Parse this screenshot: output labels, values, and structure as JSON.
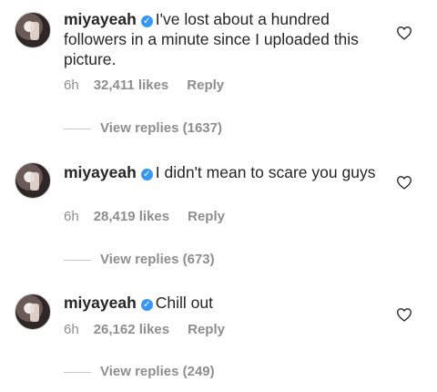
{
  "comments": [
    {
      "username": "miyayeah",
      "text": "I've lost about a hundred followers in a minute since I uploaded this picture.",
      "time": "6h",
      "likes": "32,411 likes",
      "reply": "Reply",
      "view_replies": "View replies (1637)"
    },
    {
      "username": "miyayeah",
      "text": "I didn't mean to scare you guys",
      "time": "6h",
      "likes": "28,419 likes",
      "reply": "Reply",
      "view_replies": "View replies (673)"
    },
    {
      "username": "miyayeah",
      "text": "Chill out",
      "time": "6h",
      "likes": "26,162 likes",
      "reply": "Reply",
      "view_replies": "View replies (249)"
    }
  ],
  "icons": {
    "verified": "verified-badge-icon",
    "like": "heart-outline-icon"
  },
  "colors": {
    "verified": "#3897f0",
    "secondary_text": "#8e8e8e"
  }
}
